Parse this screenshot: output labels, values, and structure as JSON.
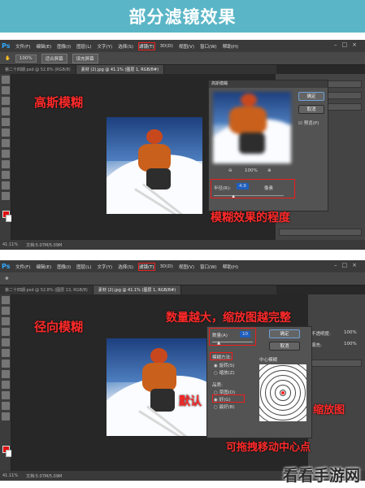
{
  "banner": {
    "title": "部分滤镜效果"
  },
  "top": {
    "menu": [
      "文件(F)",
      "编辑(E)",
      "图像(I)",
      "图层(L)",
      "文字(Y)",
      "选择(S)",
      "滤镜(T)",
      "3D(D)",
      "视图(V)",
      "窗口(W)",
      "帮助(H)"
    ],
    "menu_highlight": "滤镜(T)",
    "options": [
      "100%",
      "适合屏幕",
      "填充屏幕"
    ],
    "tabs": [
      "第二十四期.psd @ 52.8% (RGB/8)",
      "素材 (2).jpg @ 41.1% (图层 1, RGB/8#)"
    ],
    "heading": "高斯模糊",
    "dialog": {
      "title": "高斯模糊",
      "ok": "确定",
      "cancel": "取消",
      "preview": "预览(P)",
      "zoom": "100%",
      "radius_label": "半径(R):",
      "radius_value": "4.9",
      "unit": "像素"
    },
    "note": "模糊效果的程度",
    "status": [
      "41.11%",
      "文档:5.07M/5.09M"
    ]
  },
  "bottom": {
    "menu": [
      "文件(F)",
      "编辑(E)",
      "图像(I)",
      "图层(L)",
      "文字(Y)",
      "选择(S)",
      "滤镜(T)",
      "3D(D)",
      "视图(V)",
      "窗口(W)",
      "帮助(H)"
    ],
    "menu_highlight": "滤镜(T)",
    "tabs": [
      "第二十四期.psd @ 52.8% (图层 13, RGB/8)",
      "素材 (2).jpg @ 41.1% (图层 1, RGB/8#)"
    ],
    "heading": "径向模糊",
    "dialog": {
      "amount_label": "数量(A)",
      "amount_value": "10",
      "method_label": "模糊方法:",
      "method_spin": "旋转(S)",
      "method_zoom": "缩放(Z)",
      "quality_label": "品质:",
      "quality_draft": "草图(D)",
      "quality_good": "好(G)",
      "quality_best": "最好(B)",
      "center_label": "中心模糊",
      "ok": "确定",
      "cancel": "取消"
    },
    "notes": {
      "amount": "数量越大，缩放图越完整",
      "default": "默认",
      "zoom": "缩放图",
      "center": "可拖拽移动中心点"
    },
    "panel_labels": [
      "不透明度:",
      "填充:"
    ],
    "panel_values": [
      "100%",
      "100%"
    ],
    "status": [
      "41.11%",
      "文档:5.07M/5.09M"
    ]
  },
  "watermark": "看看手游网",
  "colors": {
    "accent": "#5ab6c7",
    "annotation": "#ff2020",
    "ps_blue": "#31a8ff"
  }
}
